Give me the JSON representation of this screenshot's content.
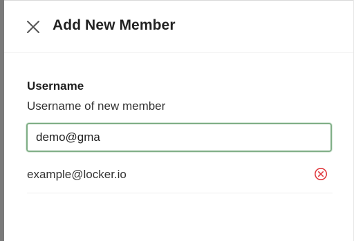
{
  "dialog": {
    "title": "Add New Member",
    "close_icon": "close-icon"
  },
  "form": {
    "username_label": "Username",
    "username_description": "Username of new member",
    "username_value": "demo@gma"
  },
  "members": [
    {
      "email": "example@locker.io",
      "remove_icon": "remove-circle-icon",
      "remove_color": "#e0393e"
    }
  ],
  "colors": {
    "input_focus_border": "#7fae86",
    "remove": "#e0393e"
  }
}
